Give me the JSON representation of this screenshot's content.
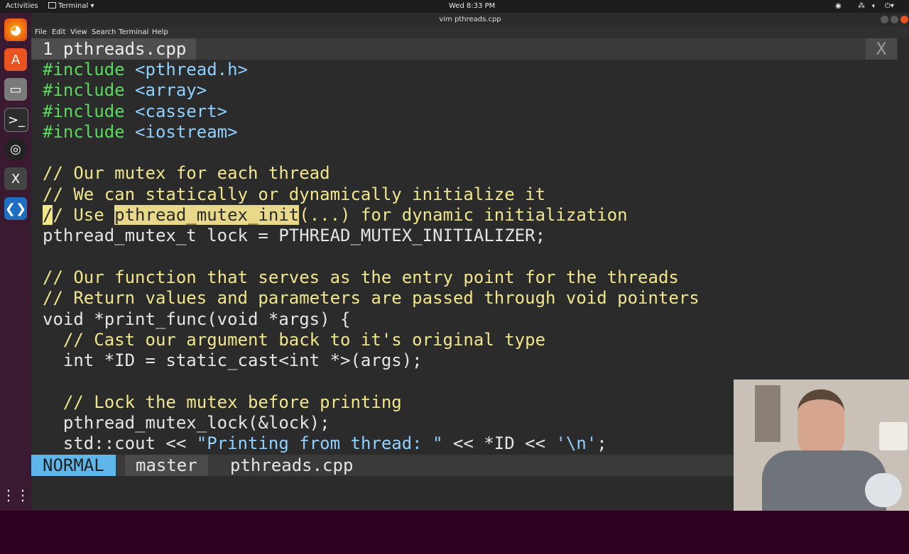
{
  "topbar": {
    "activities": "Activities",
    "app_menu": "Terminal ▾",
    "clock": "Wed  8:33 PM"
  },
  "window": {
    "title": "vim pthreads.cpp"
  },
  "menu": [
    "File",
    "Edit",
    "View",
    "Search",
    "Terminal",
    "Help"
  ],
  "vim": {
    "tab_number": "1",
    "tab_name": "pthreads.cpp",
    "tab_close": "X",
    "mode": "NORMAL",
    "branch": "master",
    "filename": "pthreads.cpp"
  },
  "code": [
    [
      [
        "inc",
        "#include "
      ],
      [
        "str",
        "<pthread.h>"
      ]
    ],
    [
      [
        "inc",
        "#include "
      ],
      [
        "str",
        "<array>"
      ]
    ],
    [
      [
        "inc",
        "#include "
      ],
      [
        "str",
        "<cassert>"
      ]
    ],
    [
      [
        "inc",
        "#include "
      ],
      [
        "str",
        "<iostream>"
      ]
    ],
    [],
    [
      [
        "cmt",
        "// Our mutex for each thread"
      ]
    ],
    [
      [
        "cmt",
        "// We can statically or dynamically initialize it"
      ]
    ],
    [
      [
        "cur",
        "/"
      ],
      [
        "cmt",
        "/ Use "
      ],
      [
        "hl",
        "pthread_mutex_init"
      ],
      [
        "cmt",
        "(...) for dynamic initialization"
      ]
    ],
    [
      [
        "typ",
        "pthread_mutex_t lock = PTHREAD_MUTEX_INITIALIZER;"
      ]
    ],
    [],
    [
      [
        "cmt",
        "// Our function that serves as the entry point for the threads"
      ]
    ],
    [
      [
        "cmt",
        "// Return values and parameters are passed through void pointers"
      ]
    ],
    [
      [
        "typ",
        "void *print_func(void *args) {"
      ]
    ],
    [
      [
        "cmt",
        "  // Cast our argument back to it's original type"
      ]
    ],
    [
      [
        "typ",
        "  int *ID = static_cast<int *>(args);"
      ]
    ],
    [],
    [
      [
        "cmt",
        "  // Lock the mutex before printing"
      ]
    ],
    [
      [
        "typ",
        "  pthread_mutex_lock(&lock);"
      ]
    ],
    [
      [
        "typ",
        "  std::cout << "
      ],
      [
        "str",
        "\"Printing from thread: \""
      ],
      [
        "typ",
        " << *ID << "
      ],
      [
        "str",
        "'\\n'"
      ],
      [
        "typ",
        ";"
      ]
    ]
  ],
  "dock_icons": [
    "firefox-icon",
    "software-center-icon",
    "files-icon",
    "terminal-icon",
    "obs-icon",
    "xcode-icon",
    "vscode-icon",
    "app-grid-icon"
  ]
}
